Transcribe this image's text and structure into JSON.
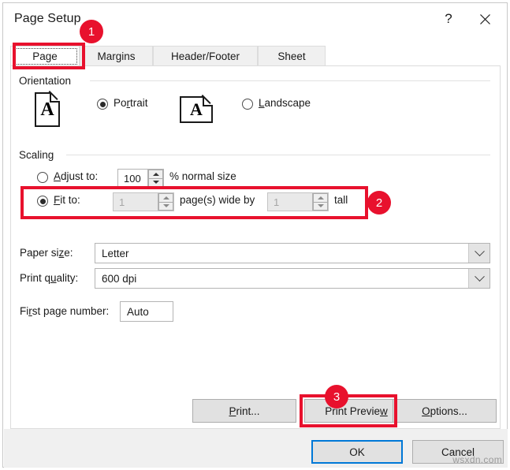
{
  "window": {
    "title": "Page Setup",
    "help_icon": "question-mark-icon",
    "close_icon": "close-icon"
  },
  "tabs": [
    {
      "label": "Page",
      "selected": true
    },
    {
      "label": "Margins",
      "selected": false
    },
    {
      "label": "Header/Footer",
      "selected": false
    },
    {
      "label": "Sheet",
      "selected": false
    }
  ],
  "orientation": {
    "group_label": "Orientation",
    "portrait": {
      "label": "Portrait",
      "selected": true,
      "icon_glyph": "A"
    },
    "landscape": {
      "label": "Landscape",
      "selected": false,
      "icon_glyph": "A"
    }
  },
  "scaling": {
    "group_label": "Scaling",
    "adjust_to": {
      "label": "Adjust to:",
      "selected": false,
      "value": "100",
      "suffix": "% normal size"
    },
    "fit_to": {
      "label": "Fit to:",
      "selected": true,
      "wide_value": "1",
      "middle_text": "page(s) wide by",
      "tall_value": "1",
      "suffix": "tall"
    }
  },
  "fields": {
    "paper_size": {
      "label": "Paper size:",
      "value": "Letter"
    },
    "print_quality": {
      "label": "Print quality:",
      "value": "600 dpi"
    },
    "first_page_number": {
      "label": "First page number:",
      "value": "Auto"
    }
  },
  "buttons": {
    "print": "Print...",
    "print_preview": "Print Preview",
    "options": "Options...",
    "ok": "OK",
    "cancel": "Cancel"
  },
  "annotations": {
    "badge_1": "1",
    "badge_2": "2",
    "badge_3": "3",
    "highlight_color": "#e8112d"
  },
  "watermark": "wsxdn.com"
}
